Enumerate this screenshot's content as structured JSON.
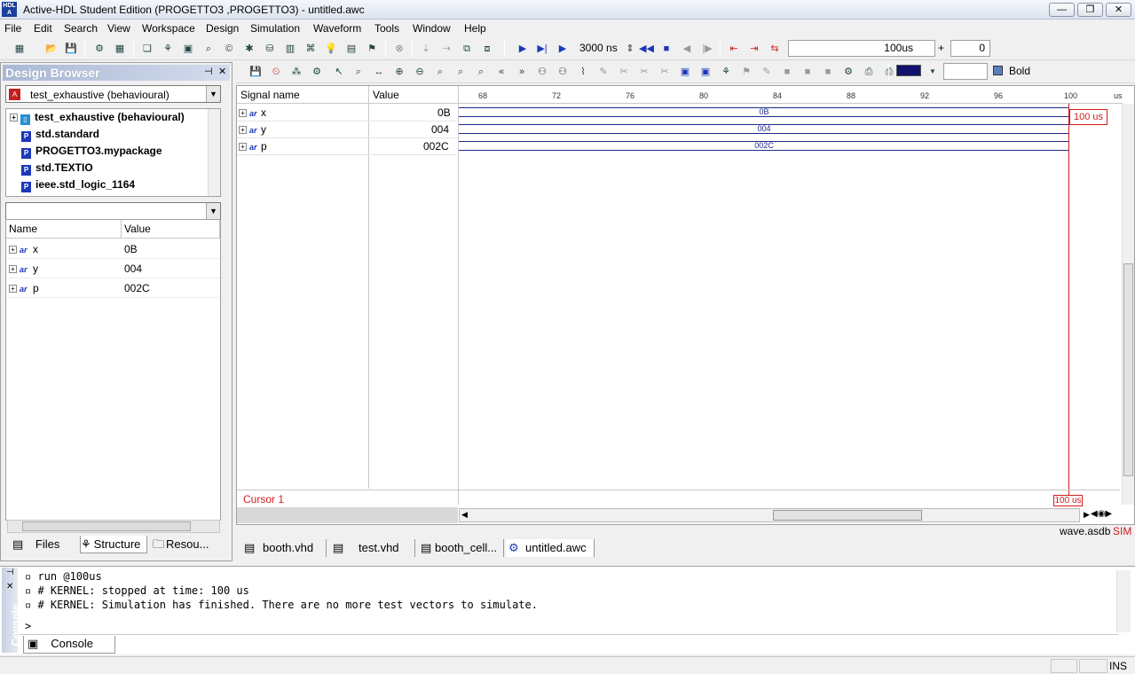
{
  "window": {
    "title": "Active-HDL Student Edition (PROGETTO3 ,PROGETTO3) - untitled.awc",
    "app_icon_text": "HDL A",
    "min": "—",
    "max": "❐",
    "close": "✕"
  },
  "menu": [
    "File",
    "Edit",
    "Search",
    "View",
    "Workspace",
    "Design",
    "Simulation",
    "Waveform",
    "Tools",
    "Window",
    "Help"
  ],
  "toolbar": {
    "sim_time": "3000 ns",
    "time_field": "100us",
    "plus": "+",
    "delta_value": "0",
    "bold_label": "Bold"
  },
  "design_browser": {
    "title": "Design Browser",
    "top_unit": "test_exhaustive (behavioural)",
    "tree": [
      "test_exhaustive (behavioural)",
      "std.standard",
      "PROGETTO3.mypackage",
      "std.TEXTIO",
      "ieee.std_logic_1164"
    ],
    "columns": {
      "name": "Name",
      "value": "Value"
    },
    "objects": [
      {
        "name": "x",
        "value": "0B"
      },
      {
        "name": "y",
        "value": "004"
      },
      {
        "name": "p",
        "value": "002C"
      }
    ],
    "tabs": [
      "Files",
      "Structure",
      "Resou..."
    ]
  },
  "waveform": {
    "columns": {
      "signal": "Signal name",
      "value": "Value"
    },
    "signals": [
      {
        "name": "x",
        "value": "0B"
      },
      {
        "name": "y",
        "value": "004"
      },
      {
        "name": "p",
        "value": "002C"
      }
    ],
    "ticks": [
      "68",
      "72",
      "76",
      "80",
      "84",
      "88",
      "92",
      "96",
      "100",
      "us"
    ],
    "cursor_label": "Cursor 1",
    "cursor_flag": "100 us",
    "cursor_bottom": "100 us",
    "db_name": "wave.asdb",
    "sim_tag": "SIM",
    "type_prefix": "ar"
  },
  "doc_tabs": [
    "booth.vhd",
    "test.vhd",
    "booth_cell...",
    "untitled.awc"
  ],
  "console": {
    "side_label": "Console",
    "lines": [
      "run @100us",
      "# KERNEL: stopped at time: 100 us",
      "# KERNEL: Simulation has finished. There are no more test vectors to simulate."
    ],
    "prompt": ">",
    "tab": "Console"
  },
  "status": {
    "ins": "INS"
  }
}
